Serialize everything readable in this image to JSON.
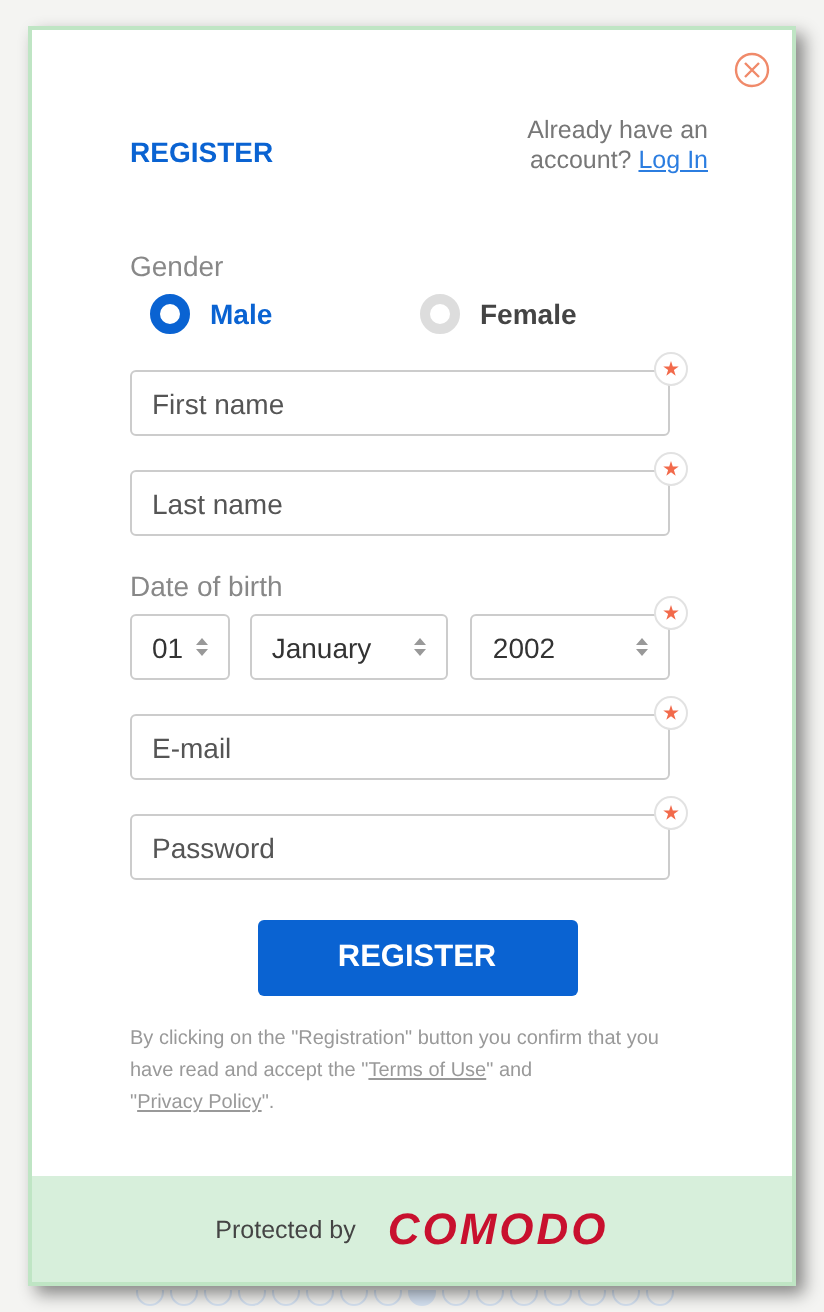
{
  "dialog": {
    "title": "REGISTER",
    "login_prompt": "Already have an account?",
    "login_link": "Log In"
  },
  "gender": {
    "label": "Gender",
    "options": [
      {
        "label": "Male",
        "selected": true
      },
      {
        "label": "Female",
        "selected": false
      }
    ]
  },
  "fields": [
    {
      "kind": "text",
      "placeholder": "First name",
      "required": true
    },
    {
      "kind": "text",
      "placeholder": "Last name",
      "required": true
    },
    {
      "kind": "date",
      "label": "Date of birth",
      "required": true,
      "selects": [
        {
          "value": "01"
        },
        {
          "value": "January"
        },
        {
          "value": "2002"
        }
      ]
    },
    {
      "kind": "text",
      "placeholder": "E-mail",
      "required": true
    },
    {
      "kind": "password",
      "placeholder": "Password",
      "required": true
    }
  ],
  "submit": "REGISTER",
  "terms": [
    {
      "text": "By clicking on the \"Registration\" button you confirm that you have read and accept the \""
    },
    {
      "text": "Terms of Use",
      "link": true
    },
    {
      "text": "\" and \""
    },
    {
      "text": "Privacy Policy",
      "link": true
    },
    {
      "text": "\"."
    }
  ],
  "footer": {
    "label": "Protected by",
    "brand": "COMODO"
  },
  "pager": [
    {
      "selected": false
    },
    {
      "selected": false
    },
    {
      "selected": false
    },
    {
      "selected": false
    },
    {
      "selected": false
    },
    {
      "selected": false
    },
    {
      "selected": false
    },
    {
      "selected": false
    },
    {
      "selected": true
    },
    {
      "selected": false
    },
    {
      "selected": false
    },
    {
      "selected": false
    },
    {
      "selected": false
    },
    {
      "selected": false
    },
    {
      "selected": false
    },
    {
      "selected": false
    }
  ]
}
